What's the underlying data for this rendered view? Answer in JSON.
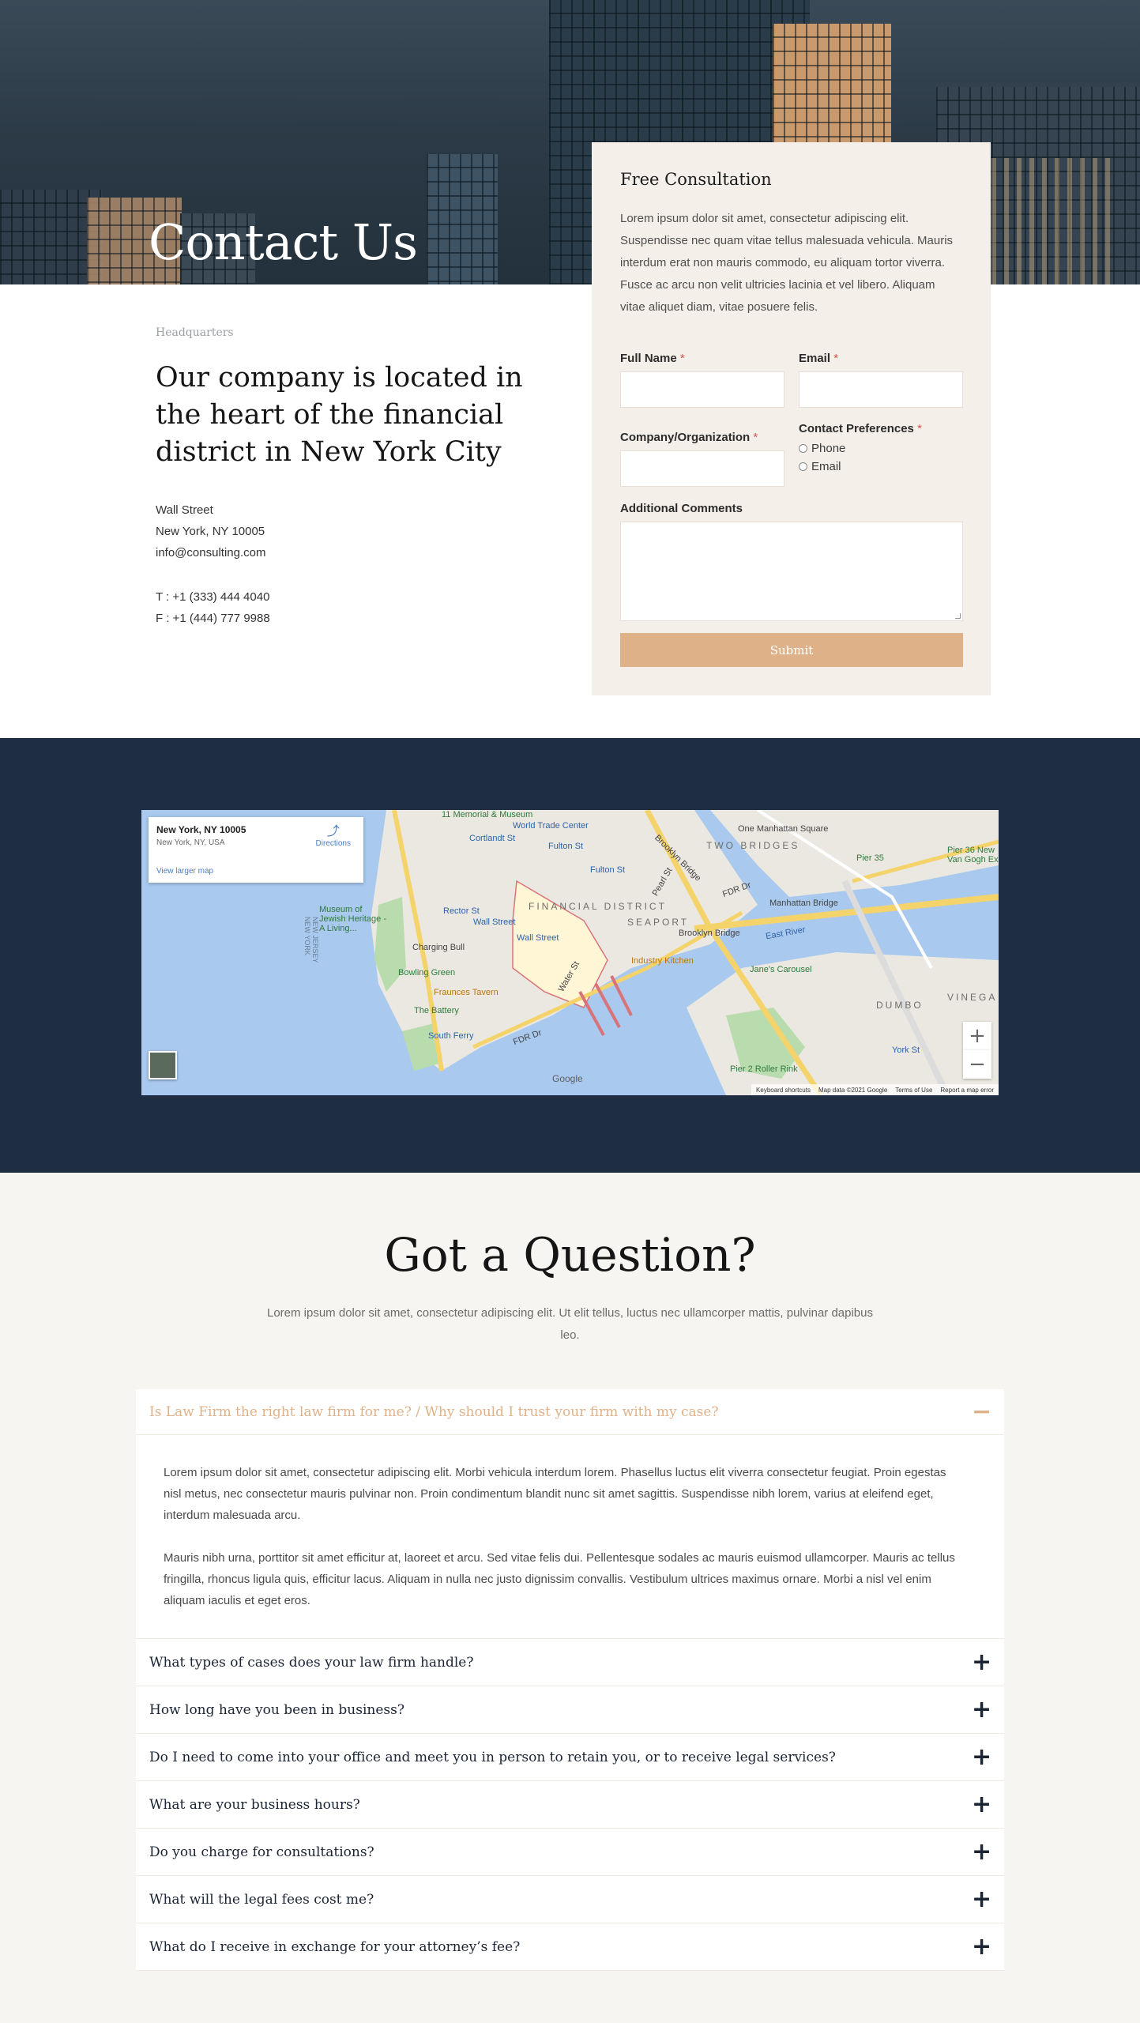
{
  "hero": {
    "title": "Contact Us"
  },
  "info": {
    "eyebrow": "Headquarters",
    "headline": "Our company is located in the heart of the financial district in New York City",
    "address": [
      "Wall Street",
      "New York, NY 10005",
      "info@consulting.com"
    ],
    "phone": "T : +1 (333) 444 4040",
    "fax": "F : +1 (444) 777 9988"
  },
  "form": {
    "title": "Free Consultation",
    "intro": "Lorem ipsum dolor sit amet, consectetur adipiscing elit. Suspendisse nec quam vitae tellus malesuada vehicula. Mauris interdum erat non mauris commodo, eu aliquam tortor viverra. Fusce ac arcu non velit ultricies lacinia et vel libero. Aliquam vitae aliquet diam, vitae posuere felis.",
    "full_name_label": "Full Name",
    "email_label": "Email",
    "company_label": "Company/Organization",
    "contact_pref_label": "Contact Preferences",
    "pref_phone": "Phone",
    "pref_email": "Email",
    "comments_label": "Additional Comments",
    "required_mark": "*",
    "submit_label": "Submit"
  },
  "map": {
    "place_title": "New York, NY 10005",
    "place_sub": "New York, NY, USA",
    "directions": "Directions",
    "larger_map": "View larger map",
    "labels": {
      "financial_district": "FINANCIAL DISTRICT",
      "seaport": "SEAPORT",
      "two_bridges": "TWO BRIDGES",
      "dumbo": "DUMBO",
      "vinegar": "VINEGA",
      "wtc": "World Trade Center",
      "fulton1": "Fulton St",
      "fulton2": "Fulton St",
      "fulton3": "Fulton St",
      "cortlandt": "Cortlandt St",
      "rector": "Rector St",
      "wall_st1": "Wall Street",
      "wall_st2": "Wall Street",
      "museum": "Museum of Jewish Heritage - A Living...",
      "charging_bull": "Charging Bull",
      "bowling_green": "Bowling Green",
      "fraunces": "Fraunces Tavern",
      "battery": "The Battery",
      "south_ferry": "South Ferry",
      "industry": "Industry Kitchen",
      "brooklyn_bridge": "Brooklyn Bridge",
      "manhattan_bridge": "Manhattan Bridge",
      "one_manhattan": "One Manhattan Square",
      "pier35": "Pier 35",
      "pier36": "Pier 36 New Van Gogh Ex",
      "brooklyn_heights": "Brooklyn Bridge",
      "east_river": "East River",
      "janes": "Jane's Carousel",
      "pier2": "Pier 2 Roller Rink",
      "york": "York St",
      "fdr1": "FDR Dr",
      "fdr2": "FDR Dr",
      "memorial": "11 Memorial & Museum",
      "water_st": "Water St",
      "pearl_st": "Pearl St",
      "nj_ny": "NEW JERSEY NEW YORK"
    },
    "footer": [
      "Keyboard shortcuts",
      "Map data ©2021 Google",
      "Terms of Use",
      "Report a map error"
    ],
    "google": "Google"
  },
  "faq": {
    "title": "Got a Question?",
    "subtitle": "Lorem ipsum dolor sit amet, consectetur adipiscing elit. Ut elit tellus, luctus nec ullamcorper mattis, pulvinar dapibus leo.",
    "open_question": "Is Law Firm the right law firm for me? / Why should I trust your firm with my case?",
    "open_answer": [
      "Lorem ipsum dolor sit amet, consectetur adipiscing elit. Morbi vehicula interdum lorem. Phasellus luctus elit viverra consectetur feugiat. Proin egestas nisl metus, nec consectetur mauris pulvinar non. Proin condimentum blandit nunc sit amet sagittis. Suspendisse nibh lorem, varius at eleifend eget, interdum malesuada arcu.",
      "Mauris nibh urna, porttitor sit amet efficitur at, laoreet et arcu. Sed vitae felis dui. Pellentesque sodales ac mauris euismod ullamcorper. Mauris ac tellus fringilla, rhoncus ligula quis, efficitur lacus. Aliquam in nulla nec justo dignissim convallis. Vestibulum ultrices maximus ornare. Morbi a nisl vel enim aliquam iaculis et eget eros."
    ],
    "questions": [
      "What types of cases does your law firm handle?",
      "How long have you been in business?",
      "Do I need to come into your office and meet you in person to retain you, or to receive legal services?",
      "What are your business hours?",
      "Do you charge for consultations?",
      "What will the legal fees cost me?",
      "What do I receive in exchange for your attorney’s fee?"
    ],
    "collapse_icon": "−",
    "expand_icon": "+"
  },
  "colors": {
    "accent": "#dfb189",
    "navy": "#1f2d42",
    "card_bg": "#f4efe8",
    "faq_bg": "#f7f5f1",
    "required": "#d9534f"
  }
}
